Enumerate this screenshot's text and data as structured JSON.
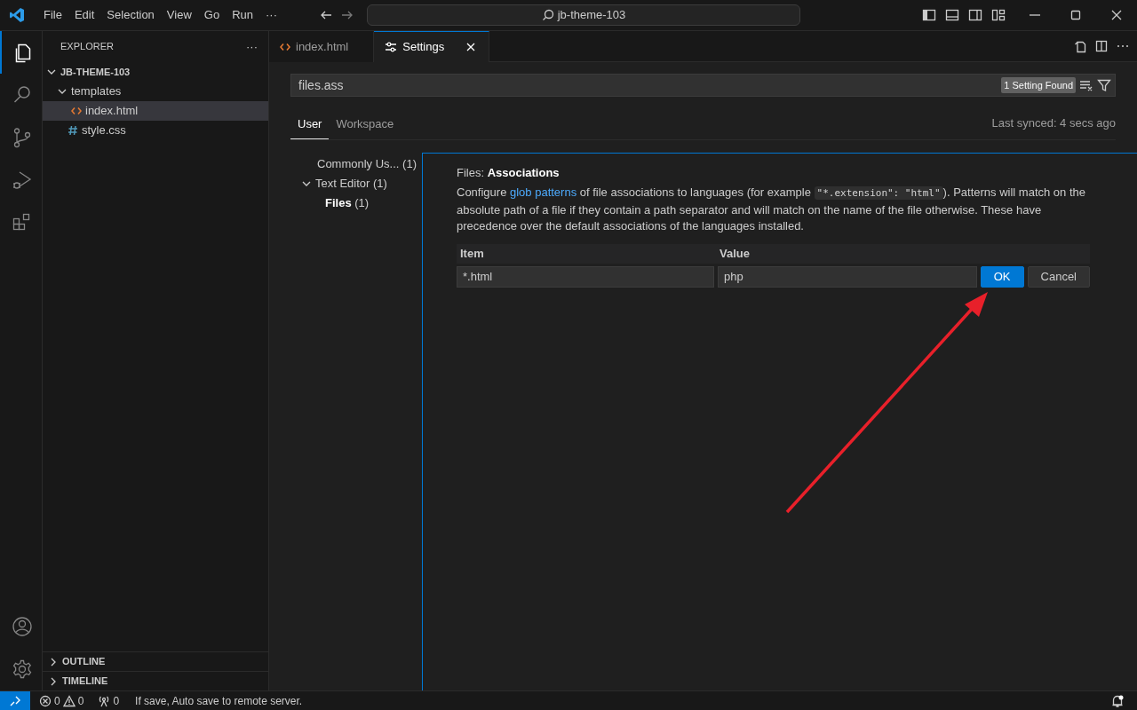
{
  "titlebar": {
    "menu": [
      "File",
      "Edit",
      "Selection",
      "View",
      "Go",
      "Run",
      "···"
    ],
    "command_center": "jb-theme-103"
  },
  "activity_bar": [
    {
      "kind": "files",
      "selected": true
    },
    {
      "kind": "search",
      "selected": false
    },
    {
      "kind": "source-control",
      "selected": false
    },
    {
      "kind": "run-debug",
      "selected": false
    },
    {
      "kind": "extensions",
      "selected": false
    }
  ],
  "explorer": {
    "title": "EXPLORER",
    "more": "···",
    "tree": [
      {
        "label": "JB-THEME-103",
        "kind": "root",
        "expanded": true,
        "selected": false,
        "children": [
          {
            "label": "templates",
            "kind": "folder",
            "expanded": true,
            "selected": false,
            "children": [
              {
                "label": "index.html",
                "kind": "html",
                "selected": true
              }
            ]
          },
          {
            "label": "style.css",
            "kind": "css",
            "selected": false
          }
        ]
      }
    ],
    "sections": [
      {
        "label": "OUTLINE",
        "expanded": false
      },
      {
        "label": "TIMELINE",
        "expanded": false
      }
    ]
  },
  "tabs": [
    {
      "label": "index.html",
      "kind": "html",
      "selected": false
    },
    {
      "label": "Settings",
      "kind": "settings",
      "selected": true
    }
  ],
  "settings": {
    "search": {
      "value": "files.ass",
      "count": "1 Setting Found"
    },
    "scopes": [
      {
        "label": "User",
        "selected": true
      },
      {
        "label": "Workspace",
        "selected": false
      }
    ],
    "last_synced": "Last synced: 4 secs ago",
    "toc": [
      {
        "label": "Commonly Us...",
        "count": "(1)",
        "selected": false
      },
      {
        "label": "Text Editor",
        "count": "(1)",
        "expanded": true,
        "selected": false,
        "children": [
          {
            "label": "Files",
            "count": "(1)",
            "selected": true
          }
        ]
      }
    ],
    "setting": {
      "category": "Files:",
      "name": "Associations",
      "description": [
        {
          "kind": "text",
          "text": "Configure "
        },
        {
          "kind": "link",
          "text": "glob patterns"
        },
        {
          "kind": "text",
          "text": " of file associations to languages (for example "
        },
        {
          "kind": "code",
          "text": "\"*.extension\": \"html\""
        },
        {
          "kind": "text",
          "text": "). Patterns will match on the absolute path of a file if they contain a path separator and will match on the name of the file otherwise. These have precedence over the default associations of the languages installed."
        }
      ],
      "columns": [
        "Item",
        "Value"
      ],
      "edit_row": {
        "item": "*.html",
        "value": "php"
      },
      "buttons": [
        {
          "label": "OK",
          "kind": "primary"
        },
        {
          "label": "Cancel",
          "kind": "secondary"
        }
      ]
    }
  },
  "status_bar": {
    "errors": "0",
    "warnings": "0",
    "ports": "0",
    "message": "If save, Auto save to remote server."
  }
}
